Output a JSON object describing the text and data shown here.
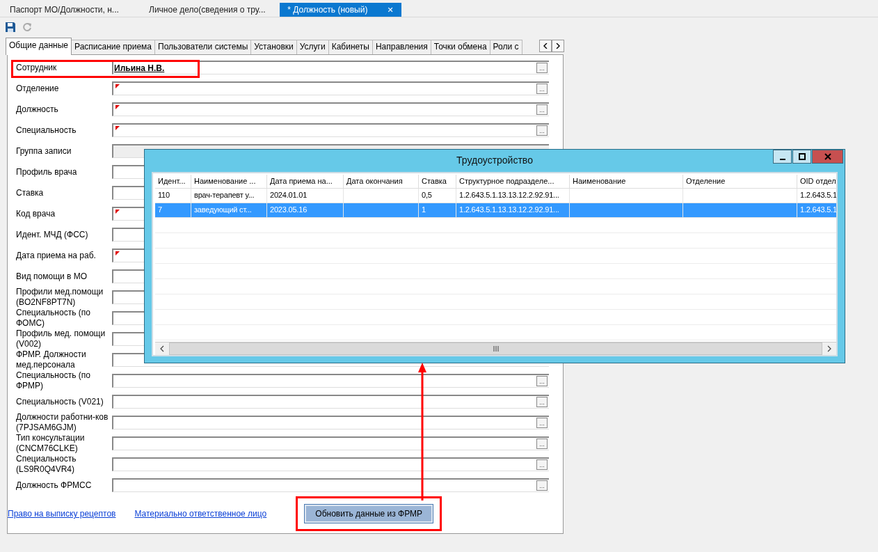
{
  "doc_tabs": [
    {
      "label": "Паспорт МО/Должности, н...",
      "selected": false,
      "closable": false
    },
    {
      "label": "Личное дело(сведения о тру...",
      "selected": false,
      "closable": false
    },
    {
      "label": "* Должность (новый)",
      "selected": true,
      "closable": true
    }
  ],
  "close_glyph": "✕",
  "tabs": [
    {
      "label": "Общие данные",
      "selected": true
    },
    {
      "label": "Расписание приема",
      "selected": false
    },
    {
      "label": "Пользователи системы",
      "selected": false
    },
    {
      "label": "Установки",
      "selected": false
    },
    {
      "label": "Услуги",
      "selected": false
    },
    {
      "label": "Кабинеты",
      "selected": false
    },
    {
      "label": "Направления",
      "selected": false
    },
    {
      "label": "Точки обмена",
      "selected": false
    },
    {
      "label": "Роли с",
      "selected": false
    }
  ],
  "fields": [
    {
      "label": "Сотрудник",
      "value": "Ильина Н.В.",
      "required": false,
      "disabled": false,
      "button": true,
      "highlighted": true
    },
    {
      "label": "Отделение",
      "required": true,
      "disabled": false,
      "button": true,
      "highlighted": false
    },
    {
      "label": "Должность",
      "required": true,
      "disabled": false,
      "button": true,
      "highlighted": false
    },
    {
      "label": "Специальность",
      "required": true,
      "disabled": false,
      "button": true,
      "highlighted": false
    },
    {
      "label": "Группа записи",
      "required": false,
      "disabled": true,
      "button": false,
      "highlighted": false
    },
    {
      "label": "Профиль врача",
      "required": false,
      "disabled": false,
      "button": false,
      "highlighted": false
    },
    {
      "label": "Ставка",
      "required": false,
      "disabled": false,
      "button": false,
      "highlighted": false
    },
    {
      "label": "Код врача",
      "required": true,
      "disabled": false,
      "button": false,
      "highlighted": false
    },
    {
      "label": "Идент. МЧД (ФСС)",
      "required": false,
      "disabled": false,
      "button": false,
      "highlighted": false
    },
    {
      "label": "Дата приема на раб.",
      "required": true,
      "disabled": false,
      "button": false,
      "highlighted": false
    },
    {
      "label": "Вид помощи в МО",
      "required": false,
      "disabled": false,
      "button": false,
      "highlighted": false
    },
    {
      "label": "Профили мед.помощи (BO2NF8PT7N)",
      "required": false,
      "disabled": false,
      "button": false,
      "highlighted": false
    },
    {
      "label": "Специальность (по ФОМС)",
      "required": false,
      "disabled": false,
      "button": false,
      "highlighted": false
    },
    {
      "label": "Профиль мед. помощи (V002)",
      "required": false,
      "disabled": false,
      "button": false,
      "highlighted": false
    },
    {
      "label": "ФРМР. Должности мед.персонала",
      "required": false,
      "disabled": false,
      "button": false,
      "highlighted": false
    },
    {
      "label": "Специальность (по ФРМР)",
      "required": false,
      "disabled": false,
      "button": true,
      "highlighted": false
    },
    {
      "label": "Специальность (V021)",
      "required": false,
      "disabled": false,
      "button": true,
      "highlighted": false
    },
    {
      "label": "Должности работни-ков (7PJSAM6GJM)",
      "required": false,
      "disabled": false,
      "button": true,
      "highlighted": false
    },
    {
      "label": "Тип консультации (CNCM76CLKE)",
      "required": false,
      "disabled": false,
      "button": true,
      "highlighted": false
    },
    {
      "label": "Специальность (LS9R0Q4VR4)",
      "required": false,
      "disabled": false,
      "button": true,
      "highlighted": false
    },
    {
      "label": "Должность ФРМСС",
      "required": false,
      "disabled": false,
      "button": true,
      "highlighted": false
    }
  ],
  "button_glyph": "...",
  "links": [
    "Право на выписку рецептов",
    "Материально ответственное лицо"
  ],
  "update_button": {
    "label": "Обновить данные из ФРМР",
    "highlighted": true
  },
  "dialog": {
    "title": "Трудоустройство",
    "columns": [
      "Идент...",
      "Наименование ...",
      "Дата приема на...",
      "Дата окончания",
      "Ставка",
      "Структурное подразделе...",
      "Наименование",
      "Отделение",
      "OID отдел"
    ],
    "rows": [
      {
        "selected": false,
        "cells": [
          "110",
          "врач-терапевт у...",
          "2024.01.01",
          "",
          "0,5",
          "1.2.643.5.1.13.13.12.2.92.91...",
          "",
          "",
          "1.2.643.5.1"
        ]
      },
      {
        "selected": true,
        "cells": [
          "7",
          "заведующий ст...",
          "2023.05.16",
          "",
          "1",
          "1.2.643.5.1.13.13.12.2.92.91...",
          "",
          "",
          "1.2.643.5.1"
        ]
      }
    ]
  }
}
